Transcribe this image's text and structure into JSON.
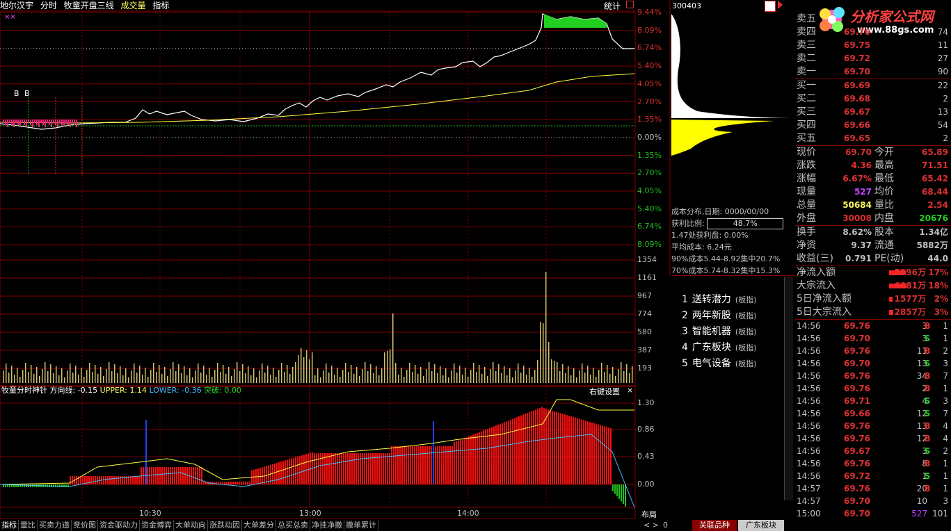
{
  "topbar": {
    "stock_name": "地尔汉宇",
    "items": [
      "分时",
      "牧童开盘三线",
      "成交量",
      "指标"
    ],
    "stats": "统计"
  },
  "y_price_labels": [
    "9.44%",
    "8.09%",
    "6.74%",
    "5.40%",
    "4.05%",
    "2.70%",
    "1.35%",
    "0.00%",
    "1.35%",
    "2.70%",
    "4.05%",
    "5.40%",
    "6.74%",
    "8.09%"
  ],
  "y_volume_labels": [
    "1354",
    "1161",
    "967",
    "774",
    "580",
    "387",
    "193"
  ],
  "y_indicator_labels": [
    "1.30",
    "0.86",
    "0.43",
    "0.00"
  ],
  "x_time_labels": [
    "10:30",
    "13:00",
    "14:00"
  ],
  "markers": {
    "b1": "B",
    "b2": "B",
    "xx": "××"
  },
  "indicator": {
    "name": "牧童分时神针",
    "direction": "方向线: -0.15",
    "upper": "UPPER: 1.14",
    "lower": "LOWER: -0.36",
    "breakout": "突破: 0.00",
    "right_settings": "右键设置",
    "close": "×"
  },
  "code": "300403",
  "cost": {
    "date_line": "成本分布,日期: 0000/00/00",
    "ratio_label": "获利比例:",
    "ratio_value": "48.7%",
    "profit_line": "1.47处获利盘: 0.00%",
    "avg_cost": "平均成本: 6.24元",
    "c90": "90%成本5.44-8.92集中20.7%",
    "c70": "70%成本5.74-8.32集中15.3%"
  },
  "sectors": [
    {
      "no": "1",
      "name": "送转潜力",
      "tag": "(板指)"
    },
    {
      "no": "2",
      "name": "两年新股",
      "tag": "(板指)"
    },
    {
      "no": "3",
      "name": "智能机器",
      "tag": "(板指)"
    },
    {
      "no": "4",
      "name": "广东板块",
      "tag": "(板指)"
    },
    {
      "no": "5",
      "name": "电气设备",
      "tag": "(板指)"
    }
  ],
  "order_book": {
    "sells": [
      {
        "label": "卖五",
        "price": "",
        "vol": ""
      },
      {
        "label": "卖四",
        "price": "69.76",
        "vol": "74"
      },
      {
        "label": "卖三",
        "price": "69.75",
        "vol": "11"
      },
      {
        "label": "卖二",
        "price": "69.72",
        "vol": "27"
      },
      {
        "label": "卖一",
        "price": "69.70",
        "vol": "90"
      }
    ],
    "buys": [
      {
        "label": "买一",
        "price": "69.69",
        "vol": "22"
      },
      {
        "label": "买二",
        "price": "69.68",
        "vol": "2"
      },
      {
        "label": "买三",
        "price": "69.67",
        "vol": "13"
      },
      {
        "label": "买四",
        "price": "69.66",
        "vol": "54"
      },
      {
        "label": "买五",
        "price": "69.65",
        "vol": "2"
      }
    ]
  },
  "stats": [
    {
      "l1": "现价",
      "v1": "69.70",
      "l2": "今开",
      "v2": "65.89",
      "c1": "#e03030",
      "c2": "#e03030"
    },
    {
      "l1": "涨跌",
      "v1": "4.36",
      "l2": "最高",
      "v2": "71.51",
      "c1": "#e03030",
      "c2": "#e03030"
    },
    {
      "l1": "涨幅",
      "v1": "6.67%",
      "l2": "最低",
      "v2": "65.42",
      "c1": "#e03030",
      "c2": "#e03030"
    },
    {
      "l1": "现量",
      "v1": "527",
      "l2": "均价",
      "v2": "68.44",
      "c1": "#c040ff",
      "c2": "#e03030"
    },
    {
      "l1": "总量",
      "v1": "50684",
      "l2": "量比",
      "v2": "2.54",
      "c1": "#ffff60",
      "c2": "#e03030"
    },
    {
      "l1": "外盘",
      "v1": "30008",
      "l2": "内盘",
      "v2": "20676",
      "c1": "#e03030",
      "c2": "#22d022"
    }
  ],
  "stats2": [
    {
      "l1": "换手",
      "v1": "8.62%",
      "l2": "股本",
      "v2": "1.34亿",
      "c1": "#c0c0c0",
      "c2": "#c0c0c0"
    },
    {
      "l1": "净资",
      "v1": "9.37",
      "l2": "流通",
      "v2": "5882万",
      "c1": "#c0c0c0",
      "c2": "#c0c0c0"
    },
    {
      "l1": "收益(三)",
      "v1": "0.791",
      "l2": "PE(动)",
      "v2": "44.0",
      "c1": "#c0c0c0",
      "c2": "#c0c0c0"
    }
  ],
  "flows": [
    {
      "label": "净流入额",
      "value": "5996万",
      "pct": "17%",
      "bar": 0.48
    },
    {
      "label": "大宗流入",
      "value": "6081万",
      "pct": "18%",
      "bar": 0.5
    },
    {
      "label": "5日净流入额",
      "value": "1577万",
      "pct": "2%",
      "bar": 0.1
    },
    {
      "label": "5日大宗流入",
      "value": "2857万",
      "pct": "3%",
      "bar": 0.12
    }
  ],
  "ticks": [
    {
      "t": "14:56",
      "p": "69.76",
      "v": "3",
      "s": "B",
      "n": "1"
    },
    {
      "t": "14:56",
      "p": "69.70",
      "v": "3",
      "s": "S",
      "n": "1"
    },
    {
      "t": "14:56",
      "p": "69.76",
      "v": "11",
      "s": "B",
      "n": "2"
    },
    {
      "t": "14:56",
      "p": "69.70",
      "v": "13",
      "s": "S",
      "n": "3"
    },
    {
      "t": "14:56",
      "p": "69.76",
      "v": "34",
      "s": "B",
      "n": "7"
    },
    {
      "t": "14:56",
      "p": "69.76",
      "v": "2",
      "s": "B",
      "n": "1"
    },
    {
      "t": "14:56",
      "p": "69.71",
      "v": "4",
      "s": "S",
      "n": "3"
    },
    {
      "t": "14:56",
      "p": "69.66",
      "v": "12",
      "s": "S",
      "n": "7"
    },
    {
      "t": "14:56",
      "p": "69.76",
      "v": "13",
      "s": "B",
      "n": "4"
    },
    {
      "t": "14:56",
      "p": "69.76",
      "v": "12",
      "s": "B",
      "n": "4"
    },
    {
      "t": "14:56",
      "p": "69.67",
      "v": "3",
      "s": "S",
      "n": "2"
    },
    {
      "t": "14:56",
      "p": "69.76",
      "v": "8",
      "s": "B",
      "n": "1"
    },
    {
      "t": "14:56",
      "p": "69.72",
      "v": "1",
      "s": "S",
      "n": "1"
    },
    {
      "t": "14:57",
      "p": "69.76",
      "v": "20",
      "s": "B",
      "n": "1"
    },
    {
      "t": "14:57",
      "p": "69.70",
      "v": "10",
      "s": "",
      "n": "3"
    },
    {
      "t": "15:00",
      "p": "69.70",
      "v": "527",
      "s": "",
      "n": "101"
    }
  ],
  "bottom_tabs": [
    "指标",
    "量比",
    "买卖力道",
    "竞价图",
    "资金驱动力",
    "资金博弈",
    "大单动向",
    "涨跌动因",
    "大单差分",
    "总买总卖",
    "净挂净撤",
    "撤单累计"
  ],
  "bottom_right": {
    "layout": "布局",
    "arrows": "< >",
    "zero": "0",
    "related": "关联品种",
    "guangdong": "广东板块"
  },
  "logo": {
    "text": "分析家公式网",
    "url": "www.88gs.com"
  },
  "colors": {
    "up": "#e03030",
    "down": "#22c022",
    "grid": "#800000",
    "yellow": "#ffff40"
  }
}
